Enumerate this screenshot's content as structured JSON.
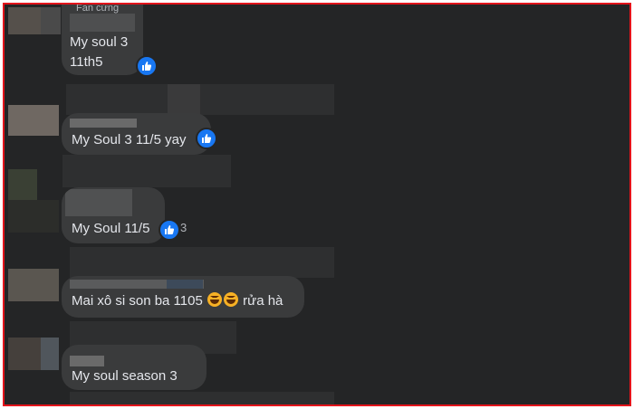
{
  "comments": [
    {
      "badge": "Fan cứng",
      "lines": [
        "My soul 3",
        "11th5"
      ],
      "reaction_icon": "like-icon",
      "reaction_count": ""
    },
    {
      "badge": "",
      "text": "My Soul 3 11/5 yay",
      "reaction_icon": "like-icon",
      "reaction_count": ""
    },
    {
      "badge": "",
      "text": "My Soul 11/5",
      "reaction_icon": "like-icon",
      "reaction_count": "3"
    },
    {
      "badge": "",
      "text_before": "Mai xô si son ba 1105",
      "emoji": [
        "laughing-emoji",
        "laughing-emoji"
      ],
      "text_after": "rửa hà",
      "reaction_icon": "",
      "reaction_count": ""
    },
    {
      "badge": "",
      "text": "My soul season 3",
      "reaction_icon": "",
      "reaction_count": ""
    }
  ],
  "colors": {
    "background": "#242526",
    "bubble": "#3a3b3c",
    "text": "#e4e6eb",
    "like": "#1877f2",
    "frame_border": "#e3141b"
  }
}
